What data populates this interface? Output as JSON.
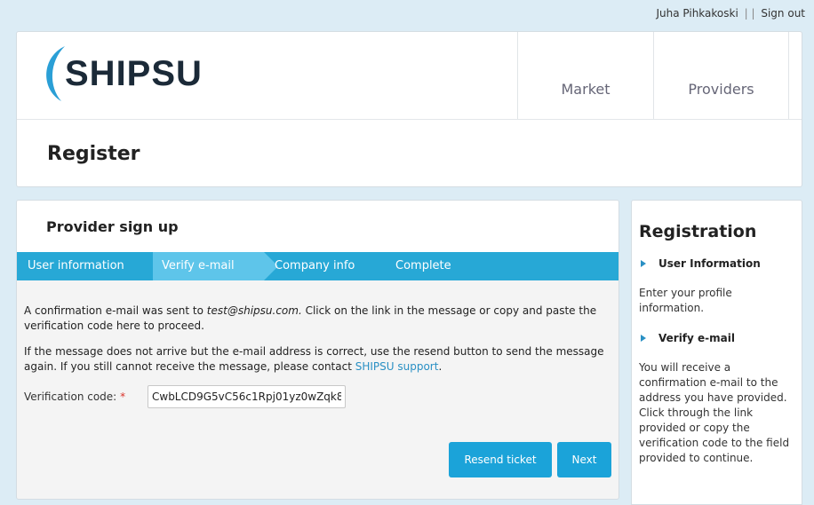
{
  "topbar": {
    "user": "Juha Pihkakoski",
    "separator": "| |",
    "signout": "Sign out"
  },
  "header": {
    "logo_text": "SHIPSU",
    "nav": [
      {
        "label": "Market"
      },
      {
        "label": "Providers"
      }
    ],
    "page_title": "Register"
  },
  "main": {
    "title": "Provider sign up",
    "steps": [
      {
        "label": "User information",
        "active": false
      },
      {
        "label": "Verify e-mail",
        "active": true
      },
      {
        "label": "Company info",
        "active": false
      },
      {
        "label": "Complete",
        "active": false
      }
    ],
    "para1_prefix": "A confirmation e-mail was sent to ",
    "para1_email": "test@shipsu.com.",
    "para1_suffix": " Click on the link in the message or copy and paste the verification code here to proceed.",
    "para2_prefix": "If the message does not arrive but the e-mail address is correct, use the resend button to send the message again. If you still cannot receive the message, please contact ",
    "para2_link": "SHIPSU support",
    "para2_suffix": ".",
    "verification_label": "Verification code:",
    "required_mark": "*",
    "verification_value": "CwbLCD9G5vC56c1Rpj01yz0wZqk8",
    "resend_label": "Resend ticket",
    "next_label": "Next"
  },
  "sidebar": {
    "title": "Registration",
    "items": [
      {
        "heading": "User Information",
        "text": "Enter your profile information."
      },
      {
        "heading": "Verify e-mail",
        "text": "You will receive a confirmation e-mail to the address you have provided. Click through the link provided or copy the verification code to the field provided to continue."
      }
    ]
  },
  "colors": {
    "accent": "#27a8d6",
    "active_step": "#5ec5ea",
    "button": "#1ba3d9",
    "background": "#dcecf5"
  }
}
